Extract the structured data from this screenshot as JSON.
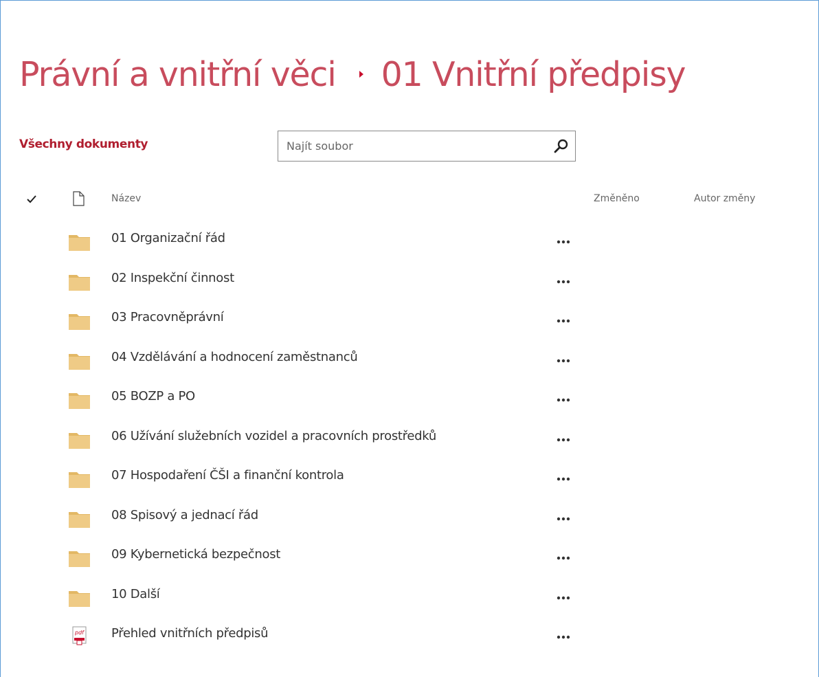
{
  "breadcrumb": {
    "parent": "Právní a vnitřní věci",
    "current": "01 Vnitřní předpisy"
  },
  "view": {
    "label": "Všechny dokumenty"
  },
  "search": {
    "placeholder": "Najít soubor",
    "value": ""
  },
  "columns": {
    "name": "Název",
    "modified": "Změněno",
    "author": "Autor změny"
  },
  "items": [
    {
      "type": "folder",
      "name": "01 Organizační řád"
    },
    {
      "type": "folder",
      "name": "02 Inspekční činnost"
    },
    {
      "type": "folder",
      "name": "03 Pracovněprávní"
    },
    {
      "type": "folder",
      "name": "04 Vzdělávání a hodnocení zaměstnanců"
    },
    {
      "type": "folder",
      "name": "05 BOZP a PO"
    },
    {
      "type": "folder",
      "name": "06 Užívání služebních vozidel a pracovních prostředků"
    },
    {
      "type": "folder",
      "name": "07 Hospodaření ČŠI a finanční kontrola"
    },
    {
      "type": "folder",
      "name": "08 Spisový a jednací řád"
    },
    {
      "type": "folder",
      "name": "09 Kybernetická bezpečnost"
    },
    {
      "type": "folder",
      "name": "10 Další"
    },
    {
      "type": "pdf",
      "name": "Přehled vnitřních předpisů"
    }
  ],
  "colors": {
    "title": "#c84c5d",
    "accent": "#b01e2f",
    "folder": "#e8c27a",
    "pdf": "#c8102e"
  },
  "icons": {
    "folder": "folder-icon",
    "pdf": "pdf-file-icon",
    "more": "ellipsis-icon",
    "search": "search-icon"
  }
}
